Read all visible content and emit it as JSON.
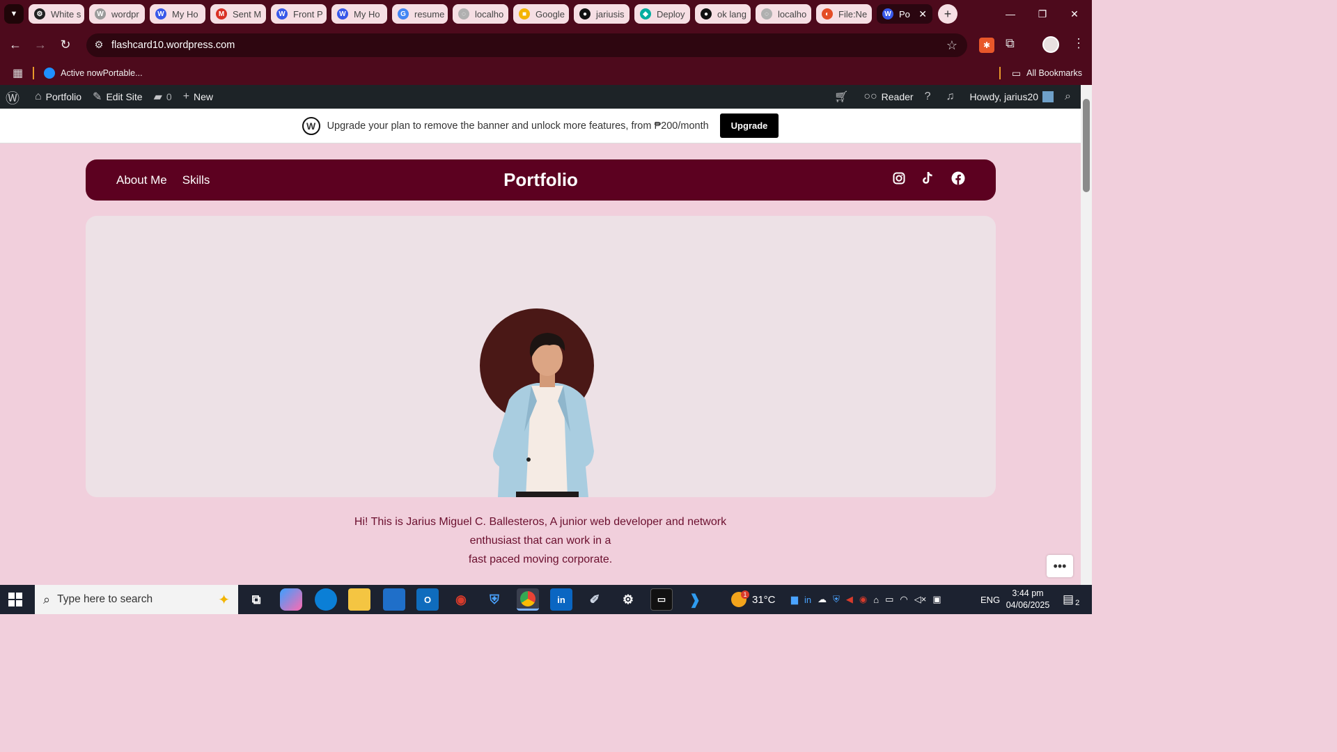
{
  "browser": {
    "tabs": [
      {
        "label": "White s",
        "fav_color": "#222222",
        "fav_glyph": "⚙"
      },
      {
        "label": "wordpr",
        "fav_color": "#9a9a9a",
        "fav_glyph": "W"
      },
      {
        "label": "My Ho",
        "fav_color": "#3858e9",
        "fav_glyph": "W"
      },
      {
        "label": "Sent M",
        "fav_color": "#d93025",
        "fav_glyph": "M"
      },
      {
        "label": "Front P",
        "fav_color": "#3858e9",
        "fav_glyph": "W"
      },
      {
        "label": "My Ho",
        "fav_color": "#3858e9",
        "fav_glyph": "W"
      },
      {
        "label": "resume",
        "fav_color": "#4285f4",
        "fav_glyph": "G"
      },
      {
        "label": "localho",
        "fav_color": "#b0b0b0",
        "fav_glyph": "◌"
      },
      {
        "label": "Google",
        "fav_color": "#f4b400",
        "fav_glyph": "■"
      },
      {
        "label": "jariusis",
        "fav_color": "#111111",
        "fav_glyph": "●"
      },
      {
        "label": "Deploy",
        "fav_color": "#00ad9f",
        "fav_glyph": "◆"
      },
      {
        "label": "ok lang",
        "fav_color": "#111111",
        "fav_glyph": "●"
      },
      {
        "label": "localho",
        "fav_color": "#b0b0b0",
        "fav_glyph": "◌"
      },
      {
        "label": "File:Ne",
        "fav_color": "#e44d26",
        "fav_glyph": "◐"
      }
    ],
    "active_tab": {
      "label": "Po",
      "fav_color": "#3858e9",
      "fav_glyph": "W"
    },
    "url": "flashcard10.wordpress.com",
    "bookmarks": {
      "active_now": "Active nowPortable...",
      "all_bookmarks": "All Bookmarks"
    }
  },
  "wp_admin_bar": {
    "site": "Portfolio",
    "edit_site": "Edit Site",
    "comments": "0",
    "new": "New",
    "reader": "Reader",
    "howdy": "Howdy, jarius20"
  },
  "banner": {
    "text": "Upgrade your plan to remove the banner and unlock more features, from ₱200/month",
    "button": "Upgrade"
  },
  "site": {
    "nav": [
      "About Me",
      "Skills"
    ],
    "title": "Portfolio",
    "social_icons": [
      "instagram-icon",
      "tiktok-icon",
      "facebook-icon"
    ],
    "bio_lines": [
      "Hi! This is Jarius Miguel C. Ballesteros, A junior web developer and network",
      "enthusiast that can work in a",
      "fast paced moving corporate."
    ]
  },
  "taskbar": {
    "search_placeholder": "Type here to search",
    "weather": "31°C",
    "language": "ENG",
    "time": "3:44 pm",
    "date": "04/06/2025",
    "notification_count": "2",
    "weather_badge": "1"
  },
  "colors": {
    "browser_frame": "#4d0a1c",
    "site_nav": "#5c0120",
    "page_bg": "#f1cfdc",
    "hero_bg": "#ede1e6",
    "bio_text": "#6b0f2e"
  }
}
